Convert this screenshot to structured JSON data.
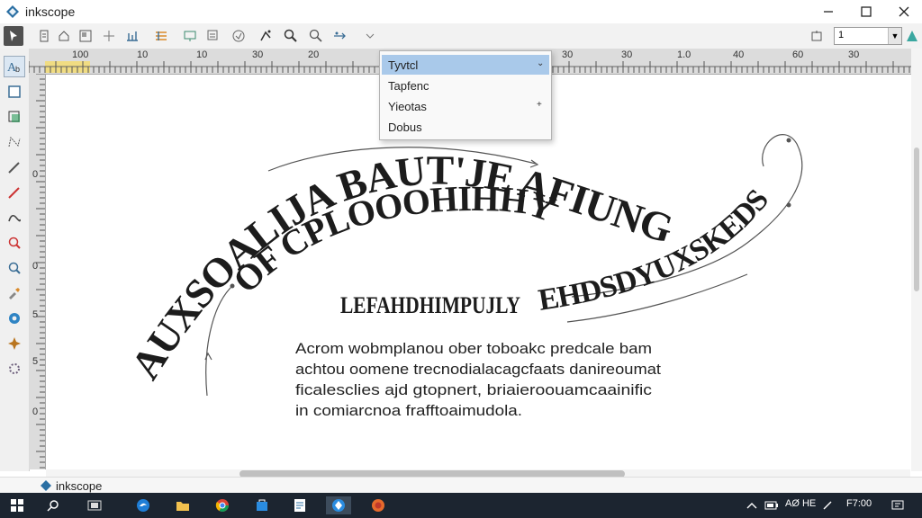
{
  "window": {
    "title": "inkscope"
  },
  "toolbar": {
    "zoom_dropdown_value": "1",
    "icons": [
      "select-icon",
      "doc-icon",
      "home-icon",
      "layout-icon",
      "guide-icon",
      "align-icon",
      "gradient-icon",
      "node-icon",
      "text-tool-icon",
      "paint-icon",
      "spray-icon",
      "zoom-icon",
      "zoom-out-icon",
      "connector-icon",
      "chevron-down-icon",
      "square-icon",
      "teal-app-icon"
    ]
  },
  "ruler": {
    "top_labels": [
      "100",
      "10",
      "10",
      "30",
      "20",
      "30",
      "30",
      "1.0",
      "40",
      "60",
      "30"
    ],
    "left_labels": [
      "0",
      "0",
      "5",
      "5",
      "0"
    ]
  },
  "menu": {
    "items": [
      {
        "label": "Tyvtcl",
        "selected": true,
        "chevron": "⌄"
      },
      {
        "label": "Tapfenc",
        "selected": false,
        "chevron": ""
      },
      {
        "label": "Yieotas",
        "selected": false,
        "chevron": "+"
      },
      {
        "label": "Dobus",
        "selected": false,
        "chevron": ""
      }
    ]
  },
  "canvas": {
    "arc_main_top": "AUXSOALIJA BAUT'JE AFIUNG OF",
    "arc_main_left": "AUXSOALIJA",
    "arc_main_rest": "BAUT'JE AFIUNG OF",
    "arc_second": "OF CPLOOOHIHHY",
    "arc_right": "EHDSDYUXSKEDS",
    "subtitle": "LEFAHDHIMPUJLY",
    "paragraph": [
      "Acrom wobmplanou ober toboakc predcale bam",
      "achtou oomene trecnodialacagcfaats danireoumat",
      "ficalesclies ajd gtopnert, briaieroouamcaainific",
      "in comiarcnoa frafftoaimudola."
    ]
  },
  "status": {
    "app_label": "inkscope"
  },
  "taskbar": {
    "tray_time": "AØ HE",
    "tray_clock": "F7:00"
  },
  "colors": {
    "menu_selected": "#a9c9ea",
    "canvas_bg": "#ffffff",
    "taskbar_bg": "#1c2530"
  }
}
